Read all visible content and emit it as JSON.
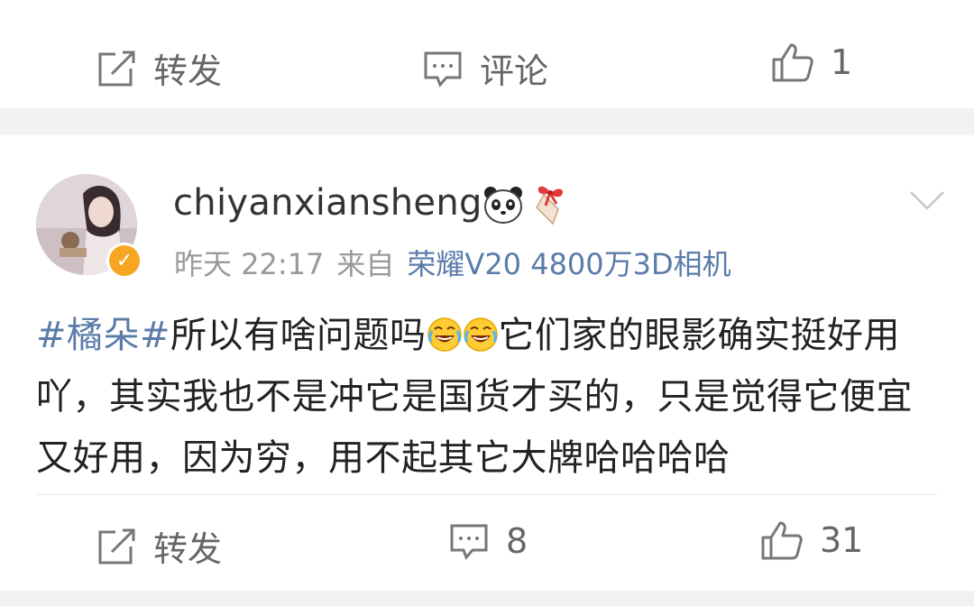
{
  "top_actions": {
    "repost_label": "转发",
    "comment_label": "评论",
    "like_count": "1"
  },
  "post": {
    "username": "chiyanxiansheng",
    "badges": [
      "panda-icon",
      "bow-badge-icon"
    ],
    "time": "昨天 22:17",
    "from_label": "来自",
    "source": "荣耀V20 4800万3D相机",
    "hashtag": "#橘朵#",
    "text_part1": "所以有啥问题吗",
    "text_part2": "它们家的眼影确实挺好用吖，其实我也不是冲它是国货才买的，只是觉得它便宜又好用，因为穷，用不起其它大牌哈哈哈哈",
    "emojis": [
      "laugh-cry-emoji",
      "laugh-cry-emoji"
    ]
  },
  "bottom_actions": {
    "repost_label": "转发",
    "comment_count": "8",
    "like_count": "31"
  },
  "colors": {
    "link_blue": "#5b7ca8",
    "verified_orange": "#f6a623",
    "gap_gray": "#f2f2f2"
  }
}
